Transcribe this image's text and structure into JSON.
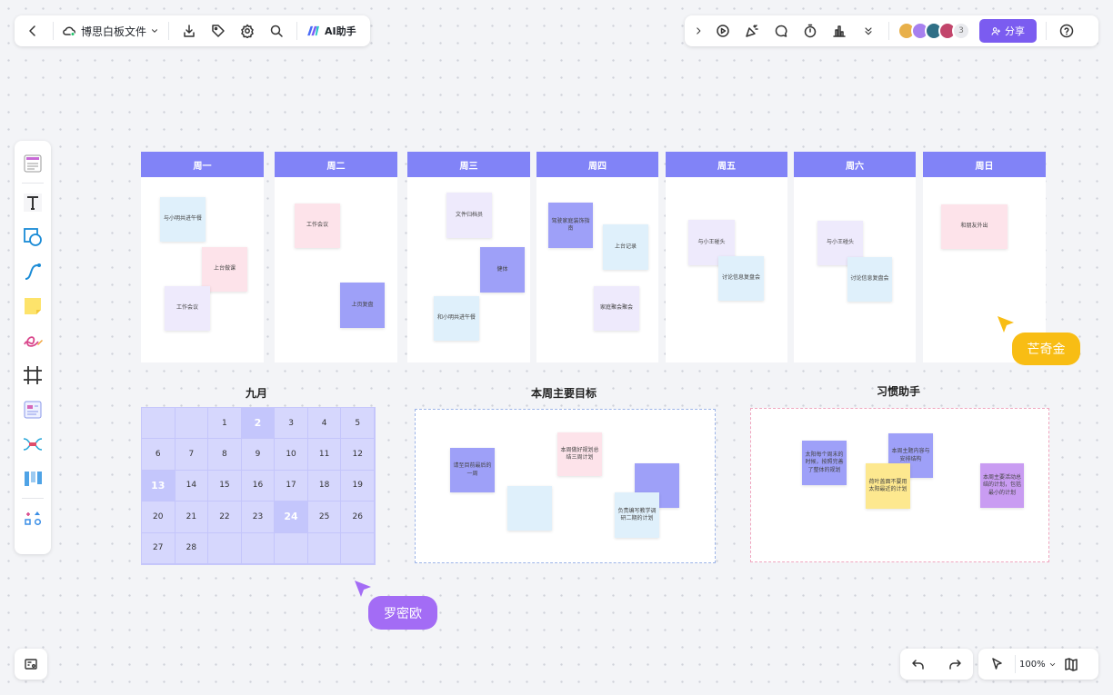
{
  "toolbar": {
    "file_name": "博思白板文件",
    "ai_label": "AI助手",
    "share_label": "分享",
    "extra_members": "3"
  },
  "week": {
    "columns": [
      {
        "name": "周一",
        "notes": [
          "与小明共进午餐",
          "上台做课",
          "工作会议"
        ]
      },
      {
        "name": "周二",
        "notes": [
          "工作会议",
          "上页复盘"
        ]
      },
      {
        "name": "周三",
        "notes": [
          "文件归档员",
          "健体",
          "和小明共进午餐"
        ]
      },
      {
        "name": "周四",
        "notes": [
          "驾驶家庭装饰指南",
          "上台记录",
          "家庭聚会聚会"
        ]
      },
      {
        "name": "周五",
        "notes": [
          "与小王碰头",
          "讨论信息复盘会"
        ]
      },
      {
        "name": "周六",
        "notes": [
          "与小王碰头",
          "讨论信息复盘会"
        ]
      },
      {
        "name": "周日",
        "notes": [
          "和朋友外出"
        ]
      }
    ]
  },
  "calendar": {
    "title": "九月",
    "cells": [
      "",
      "",
      "1",
      "2",
      "3",
      "4",
      "5",
      "6",
      "7",
      "8",
      "9",
      "10",
      "11",
      "12",
      "13",
      "14",
      "15",
      "16",
      "17",
      "18",
      "19",
      "20",
      "21",
      "22",
      "23",
      "24",
      "25",
      "26",
      "27",
      "28",
      "",
      "",
      "",
      "",
      ""
    ]
  },
  "goals": {
    "title": "本周主要目标",
    "notes": [
      "请至目前最后的一周",
      "本周做好规划总结三周计划",
      "负责编写教学调研二期的计划"
    ]
  },
  "habits": {
    "title": "习惯助手",
    "notes": [
      "太阳每个周末的时候，按照完善了整体的规划",
      "本周主题内容与安排结构",
      "荷叶盖面不要用太阳最近的计划",
      "本周主要活动总结的计划，包括最小的计划"
    ]
  },
  "cursors": {
    "user1": "芒奇金",
    "user2": "罗密欧"
  },
  "zoom": {
    "level": "100%"
  },
  "colors": {
    "accent": "#8183f7",
    "share": "#7b5cf0",
    "cursor_yellow": "#f8bd14",
    "cursor_purple": "#a36cf5"
  }
}
